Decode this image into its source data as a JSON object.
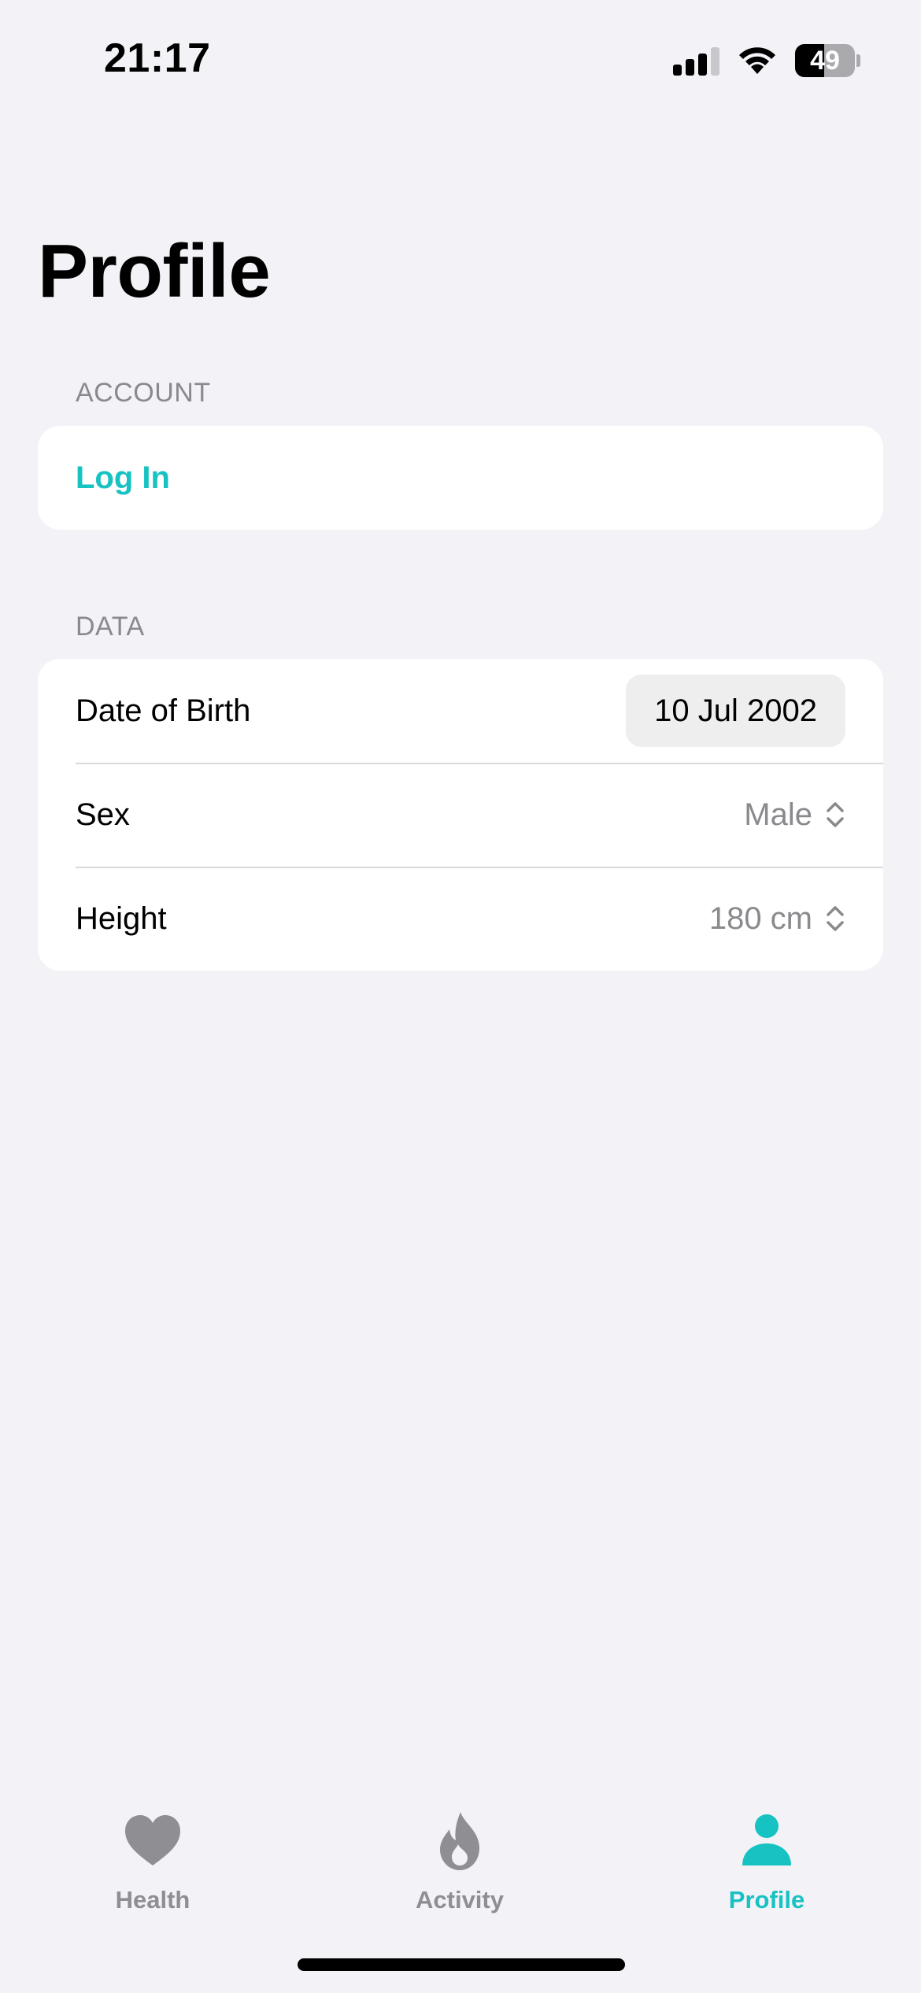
{
  "status_bar": {
    "time": "21:17",
    "battery_level": "49",
    "battery_fraction": 0.49,
    "signal_bars_active": 3,
    "signal_bars_total": 4
  },
  "page": {
    "title": "Profile"
  },
  "account_section": {
    "header": "ACCOUNT",
    "login_label": "Log In"
  },
  "data_section": {
    "header": "DATA",
    "rows": [
      {
        "label": "Date of Birth",
        "value": "10 Jul 2002"
      },
      {
        "label": "Sex",
        "value": "Male"
      },
      {
        "label": "Height",
        "value": "180 cm"
      }
    ]
  },
  "tab_bar": {
    "tabs": [
      {
        "label": "Health",
        "icon": "heart-icon",
        "active": false
      },
      {
        "label": "Activity",
        "icon": "flame-icon",
        "active": false
      },
      {
        "label": "Profile",
        "icon": "person-icon",
        "active": true
      }
    ]
  },
  "colors": {
    "accent": "#17c2c2",
    "background": "#f2f2f7",
    "secondary_text": "#8a8a8e",
    "inactive_tab": "#8e8e93"
  }
}
